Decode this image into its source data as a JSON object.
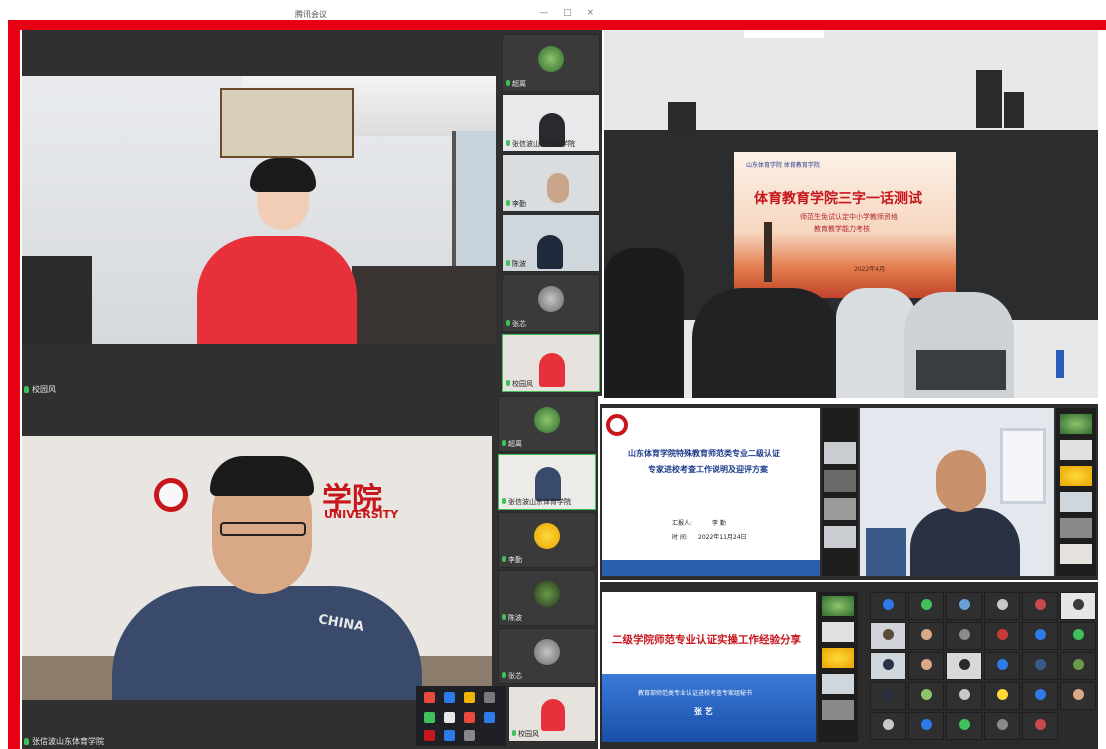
{
  "window": {
    "title": "腾讯会议",
    "controls": "— □ ×"
  },
  "colors": {
    "frame": "#e60012",
    "mic": "#3fc05a",
    "slide_red": "#c8161d"
  },
  "panel_a": {
    "main_name": "校园风",
    "thumbs": [
      "超离",
      "张信波山东体育学院",
      "李勤",
      "陈波",
      "张芯",
      "校园风"
    ]
  },
  "panel_b": {
    "slide_header": "山东体育学院 体育教育学院",
    "slide_title": "体育教育学院三字一话测试",
    "slide_sub1": "师范生免试认定中小学教师资格",
    "slide_sub2": "教育教学能力考核",
    "slide_date": "2022年4月"
  },
  "panel_c": {
    "main_name": "张信波山东体育学院",
    "logo_text": "学院",
    "logo_sub": "UNIVERSITY",
    "jacket_text": "CHINA",
    "thumbs": [
      "超离",
      "张信波山东体育学院",
      "李勤",
      "陈波",
      "张芯",
      "校园风"
    ]
  },
  "panel_d": {
    "slide_title_1": "山东体育学院特殊教育师范类专业二级认证",
    "slide_title_2": "专家进校考查工作说明及迎评方案",
    "reporter_label": "汇报人:",
    "reporter_name": "李   勤",
    "time_label": "时   间:",
    "time_value": "2022年11月24日"
  },
  "panel_e": {
    "slide_title": "二级学院师范专业认证实操工作经验分享",
    "slide_sub": "教育部师范类专业认证进校考查专家组秘书",
    "slide_name": "张   艺"
  },
  "icons": [
    "mic-icon",
    "minimize-icon",
    "maximize-icon",
    "close-icon",
    "app-icon",
    "shield-icon",
    "chat-icon",
    "wechat-icon",
    "lock-icon"
  ]
}
